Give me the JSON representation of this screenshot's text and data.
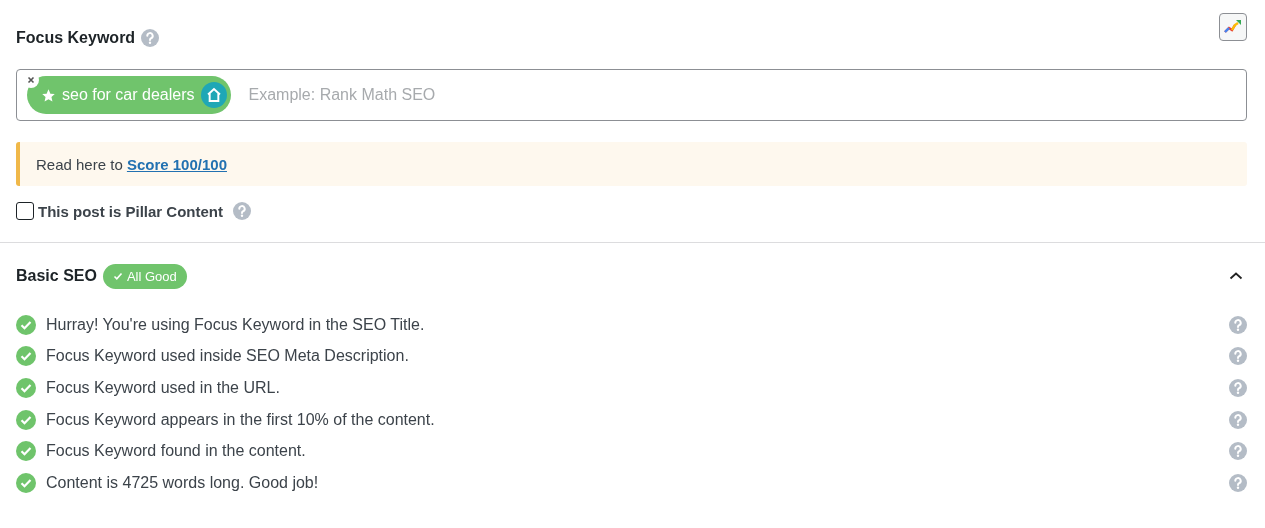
{
  "focus_keyword": {
    "label": "Focus Keyword",
    "keywords": [
      {
        "text": "seo for car dealers"
      }
    ],
    "placeholder": "Example: Rank Math SEO"
  },
  "notice": {
    "text": "Read here to ",
    "link": "Score 100/100"
  },
  "pillar": {
    "label": "This post is Pillar Content",
    "checked": false
  },
  "section": {
    "title": "Basic SEO",
    "badge": "All Good",
    "expanded": true,
    "checks": [
      {
        "text": "Hurray! You're using Focus Keyword in the SEO Title.",
        "passed": true
      },
      {
        "text": "Focus Keyword used inside SEO Meta Description.",
        "passed": true
      },
      {
        "text": "Focus Keyword used in the URL.",
        "passed": true
      },
      {
        "text": "Focus Keyword appears in the first 10% of the content.",
        "passed": true
      },
      {
        "text": "Focus Keyword found in the content.",
        "passed": true
      },
      {
        "text": "Content is 4725 words long. Good job!",
        "passed": true
      }
    ]
  }
}
